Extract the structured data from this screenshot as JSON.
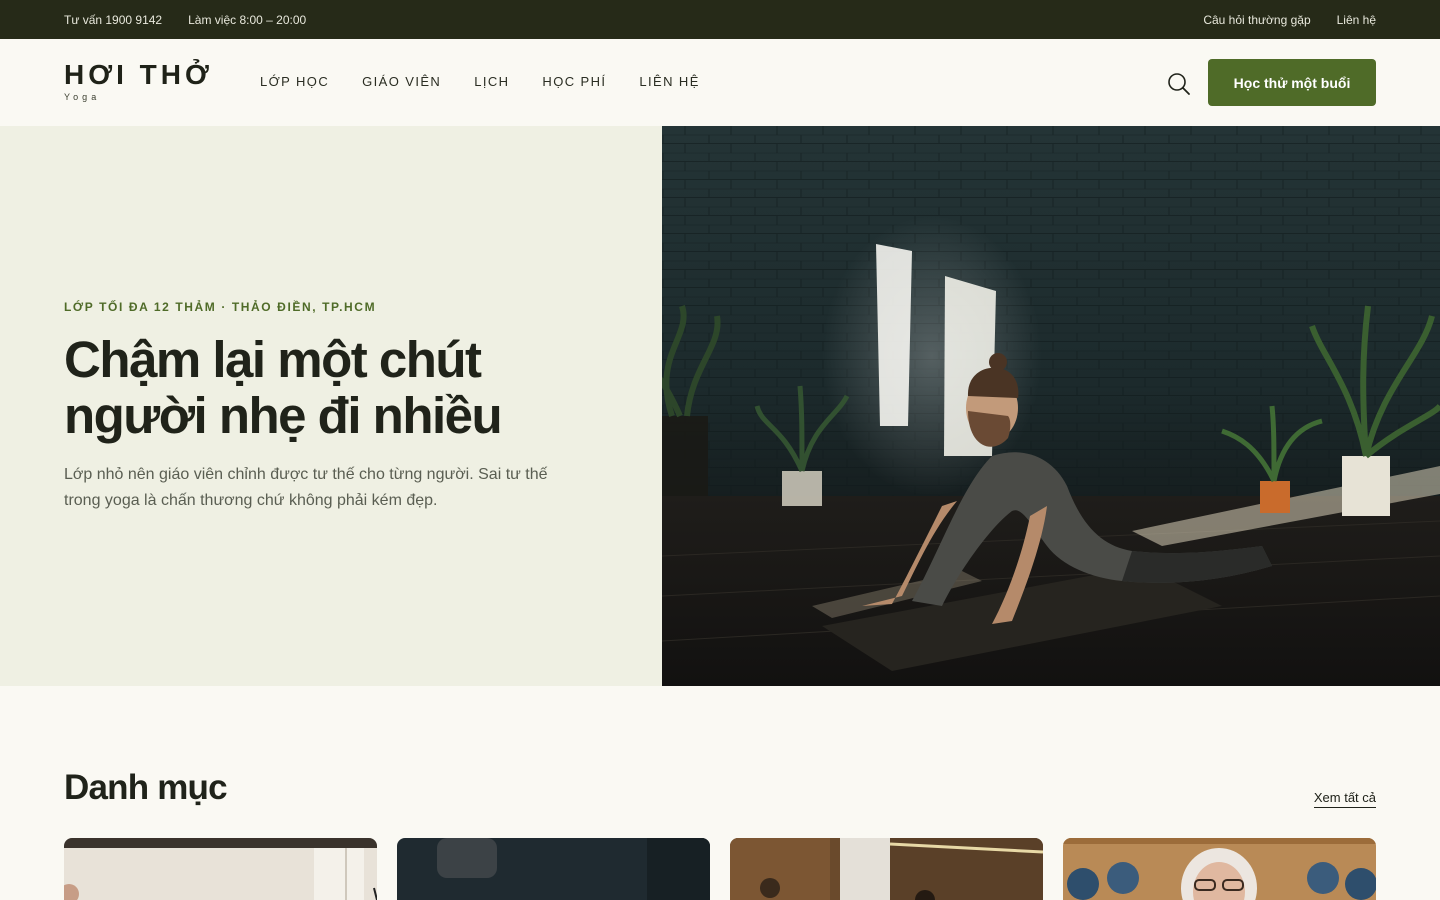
{
  "topbar": {
    "hotline": "Tư vấn 1900 9142",
    "hours": "Làm việc 8:00 – 20:00",
    "faq": "Câu hỏi thường gặp",
    "contact": "Liên hệ"
  },
  "brand": {
    "name": "HƠI THỞ",
    "subtitle": "Yoga"
  },
  "nav": {
    "items": [
      "LỚP HỌC",
      "GIÁO VIÊN",
      "LỊCH",
      "HỌC PHÍ",
      "LIÊN HỆ"
    ]
  },
  "header": {
    "search_icon": "search-icon",
    "cta_label": "Học thử một buổi"
  },
  "hero": {
    "eyebrow": "LỚP TỐI ĐA 12 THẢM · THẢO ĐIỀN, TP.HCM",
    "headline_line1": "Chậm lại một chút",
    "headline_line2": "người nhẹ đi nhiều",
    "lead": "Lớp nhỏ nên giáo viên chỉnh được tư thế cho từng người. Sai tư thế trong yoga là chấn thương chứ không phải kém đẹp."
  },
  "categories": {
    "title": "Danh mục",
    "see_all": "Xem tất cả"
  },
  "colors": {
    "accent": "#4f6b28",
    "topbar": "#262a18",
    "hero_bg": "#eff0e3",
    "page_bg": "#faf9f3"
  }
}
